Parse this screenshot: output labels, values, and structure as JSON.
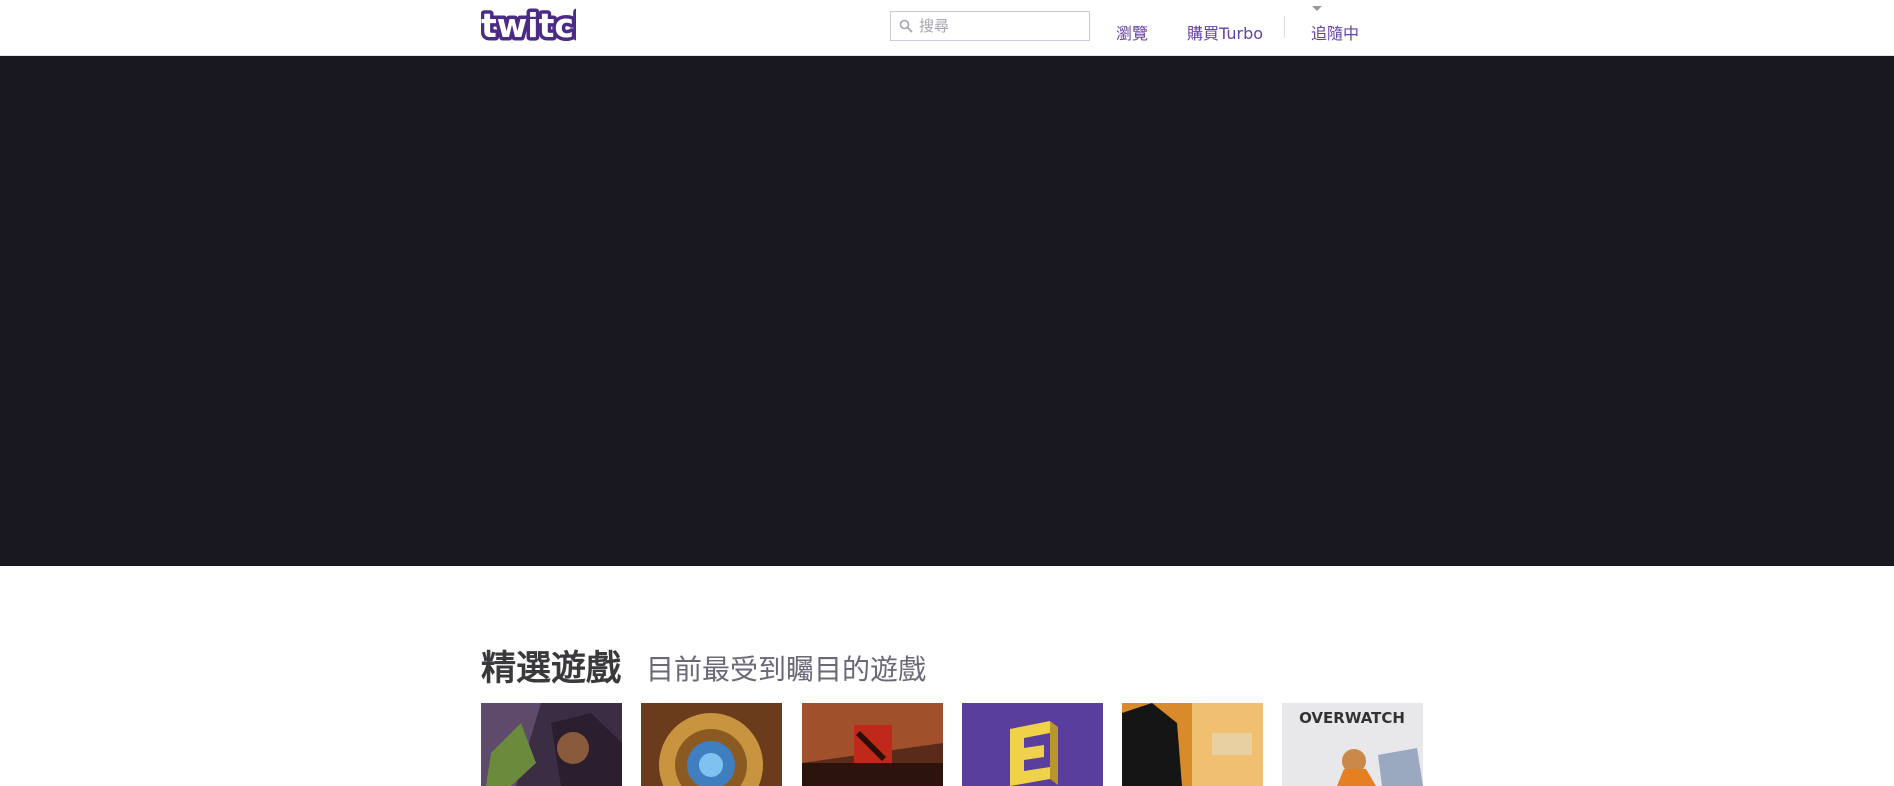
{
  "header": {
    "logo_text": "twitch",
    "search": {
      "placeholder": "搜尋"
    },
    "nav": {
      "browse": "瀏覽",
      "turbo": "購買Turbo",
      "following": "追隨中"
    }
  },
  "main": {
    "featured": {
      "title": "精選遊戲",
      "subtitle": "目前最受到矚目的遊戲"
    },
    "games": [
      {
        "label": "",
        "icon": "heroes-art"
      },
      {
        "label": "",
        "icon": "hearthstone-art"
      },
      {
        "label": "",
        "icon": "dota-art"
      },
      {
        "label": "",
        "icon": "e3-art"
      },
      {
        "label": "",
        "icon": "csgo-art"
      },
      {
        "label": "OVERWATCH",
        "icon": "overwatch-art"
      }
    ]
  },
  "colors": {
    "brand": "#6441a5",
    "hero_bg": "#19171f"
  }
}
